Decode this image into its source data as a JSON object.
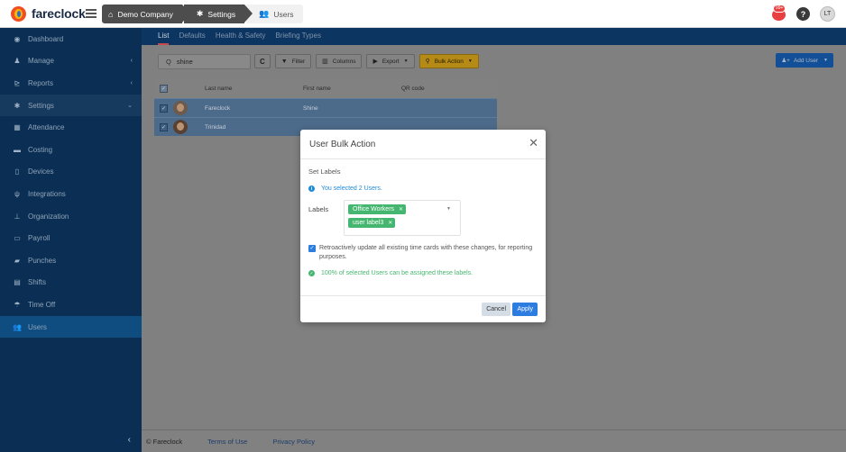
{
  "app": {
    "name": "fareclock",
    "logo_icon": "fareclock-logo-icon"
  },
  "breadcrumb": [
    {
      "label": "Demo Company",
      "icon": "home-icon"
    },
    {
      "label": "Settings",
      "icon": "gear-icon"
    },
    {
      "label": "Users",
      "icon": "users-icon"
    }
  ],
  "topbar": {
    "notification_count": "99+",
    "help_label": "?",
    "avatar_initials": "LT"
  },
  "sidebar": {
    "items": [
      {
        "label": "Dashboard",
        "icon": "dashboard-icon"
      },
      {
        "label": "Manage",
        "icon": "person-icon",
        "chevron": "‹"
      },
      {
        "label": "Reports",
        "icon": "chart-icon",
        "chevron": "‹"
      },
      {
        "label": "Settings",
        "icon": "gear-icon",
        "chevron": "⌄"
      },
      {
        "label": "Attendance",
        "icon": "table-icon"
      },
      {
        "label": "Costing",
        "icon": "folder-icon"
      },
      {
        "label": "Devices",
        "icon": "tablet-icon"
      },
      {
        "label": "Integrations",
        "icon": "plug-icon"
      },
      {
        "label": "Organization",
        "icon": "sitemap-icon"
      },
      {
        "label": "Payroll",
        "icon": "money-icon"
      },
      {
        "label": "Punches",
        "icon": "truck-icon"
      },
      {
        "label": "Shifts",
        "icon": "calendar-icon"
      },
      {
        "label": "Time Off",
        "icon": "umbrella-icon"
      },
      {
        "label": "Users",
        "icon": "users-icon"
      }
    ],
    "collapse_glyph": "‹"
  },
  "tabs": [
    {
      "label": "List",
      "active": true
    },
    {
      "label": "Defaults"
    },
    {
      "label": "Health & Safety"
    },
    {
      "label": "Briefing Types"
    }
  ],
  "toolbar": {
    "search_value": "shine",
    "refresh_glyph": "C",
    "filter_label": "Filter",
    "columns_label": "Columns",
    "export_label": "Export",
    "bulk_action_label": "Bulk Action",
    "add_user_label": "Add User"
  },
  "table": {
    "headers": {
      "last_name": "Last name",
      "first_name": "First name",
      "qr_code": "QR code"
    },
    "rows": [
      {
        "last_name": "Fareclock",
        "first_name": "Shine",
        "qr_code": ""
      },
      {
        "last_name": "Trinidad",
        "first_name": "",
        "qr_code": ""
      }
    ]
  },
  "footer": {
    "copyright": "© Fareclock",
    "terms": "Terms of Use",
    "privacy": "Privacy Policy"
  },
  "modal": {
    "title": "User Bulk Action",
    "section_title": "Set Labels",
    "info_text": "You selected 2 Users.",
    "labels_caption": "Labels",
    "tags": [
      "Office Workers",
      "user label3"
    ],
    "retro_text": "Retroactively update all existing time cards with these changes, for reporting purposes.",
    "retro_checked": true,
    "ok_text": "100% of selected Users can be assigned these labels.",
    "cancel_label": "Cancel",
    "apply_label": "Apply"
  },
  "colors": {
    "sidebar_bg": "#0b2f54",
    "accent_blue": "#2d7de1",
    "tag_green": "#44b66f",
    "bulk_yellow": "#b58a16",
    "notif_red": "#e84040"
  }
}
